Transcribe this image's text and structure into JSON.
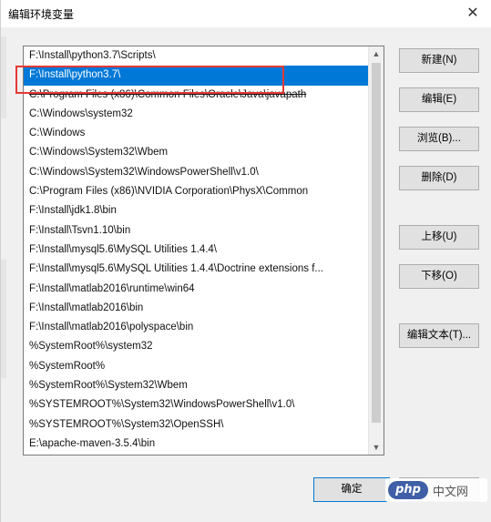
{
  "window": {
    "title": "编辑环境变量",
    "close_glyph": "✕"
  },
  "path_list": {
    "items": [
      "F:\\Install\\python3.7\\Scripts\\",
      "F:\\Install\\python3.7\\",
      "C:\\Program Files (x86)\\Common Files\\Oracle\\Java\\javapath",
      "C:\\Windows\\system32",
      "C:\\Windows",
      "C:\\Windows\\System32\\Wbem",
      "C:\\Windows\\System32\\WindowsPowerShell\\v1.0\\",
      "C:\\Program Files (x86)\\NVIDIA Corporation\\PhysX\\Common",
      "F:\\Install\\jdk1.8\\bin",
      "F:\\Install\\Tsvn1.10\\bin",
      "F:\\Install\\mysql5.6\\MySQL Utilities 1.4.4\\",
      "F:\\Install\\mysql5.6\\MySQL Utilities 1.4.4\\Doctrine extensions f...",
      "F:\\Install\\matlab2016\\runtime\\win64",
      "F:\\Install\\matlab2016\\bin",
      "F:\\Install\\matlab2016\\polyspace\\bin",
      "%SystemRoot%\\system32",
      "%SystemRoot%",
      "%SystemRoot%\\System32\\Wbem",
      "%SYSTEMROOT%\\System32\\WindowsPowerShell\\v1.0\\",
      "%SYSTEMROOT%\\System32\\OpenSSH\\",
      "E:\\apache-maven-3.5.4\\bin"
    ],
    "selected_index": 1,
    "strike_index": 2,
    "selection_color": "#0078d7",
    "highlight_color": "#e53935",
    "scroll_up_glyph": "▲",
    "scroll_down_glyph": "▼"
  },
  "buttons": {
    "new": "新建(N)",
    "edit": "编辑(E)",
    "browse": "浏览(B)...",
    "delete": "删除(D)",
    "move_up": "上移(U)",
    "move_down": "下移(O)",
    "edit_text": "编辑文本(T)...",
    "ok": "确定"
  },
  "watermark": {
    "logo": "php",
    "text": "中文网"
  }
}
